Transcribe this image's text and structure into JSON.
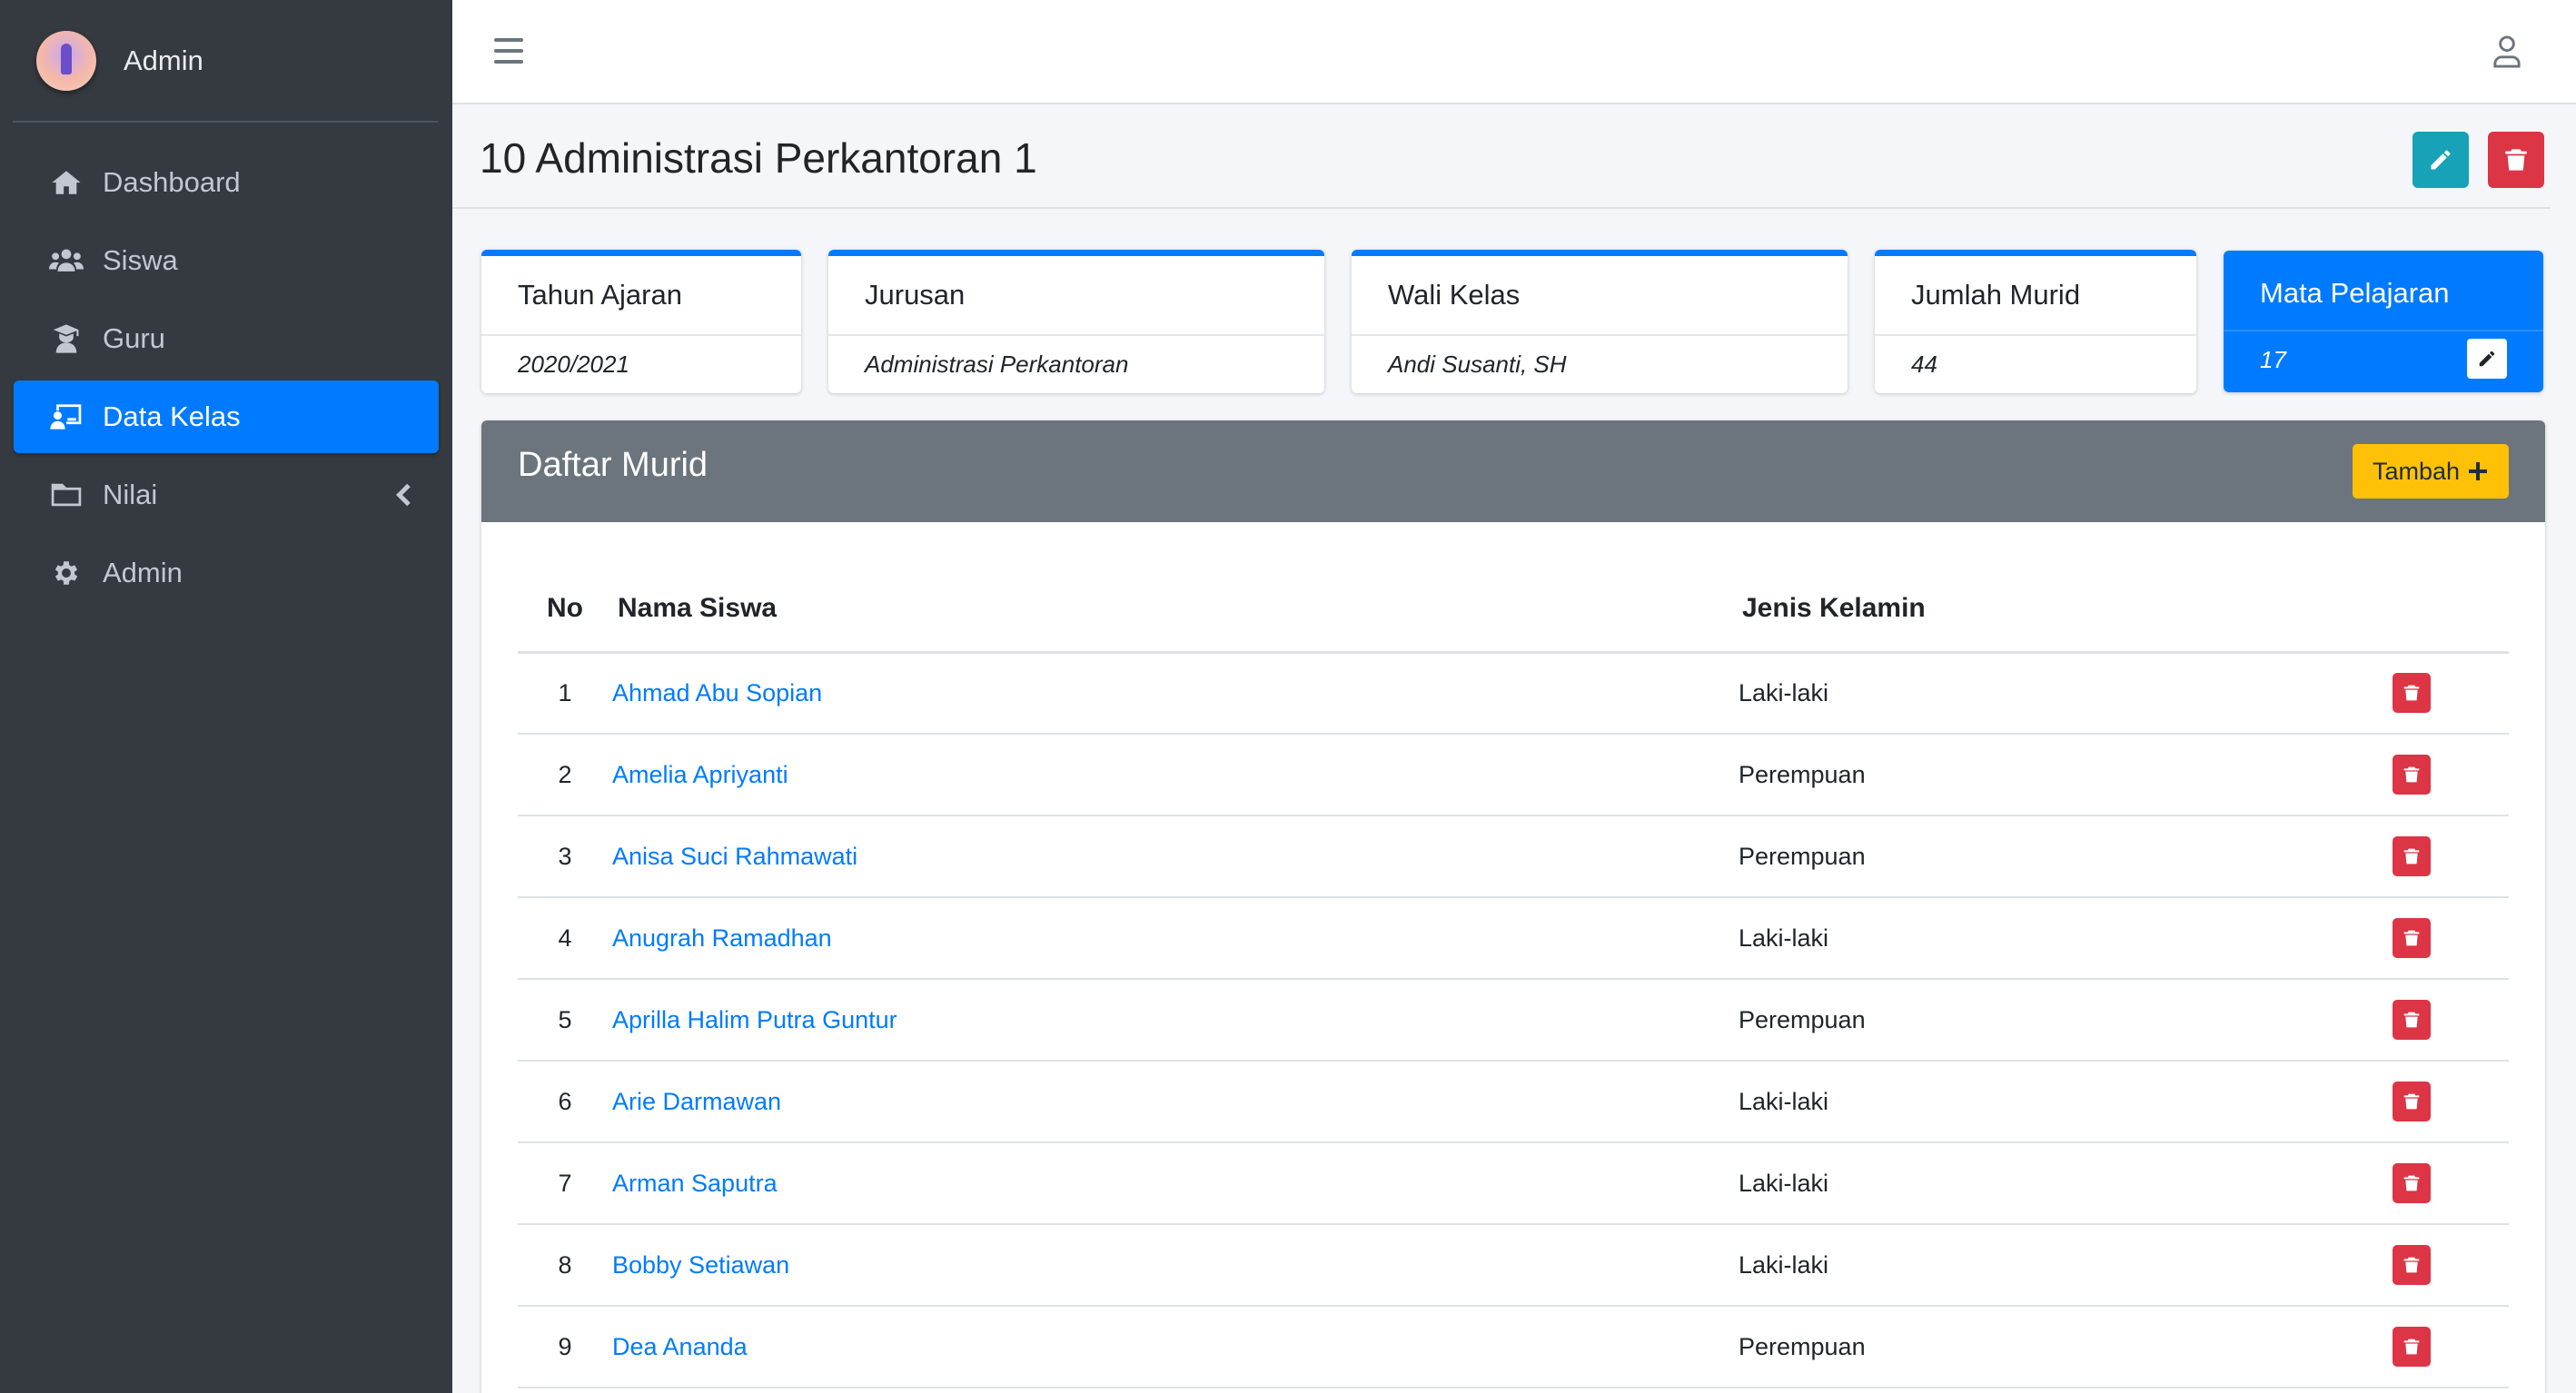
{
  "brand": {
    "user_name": "Admin"
  },
  "sidebar": {
    "items": [
      {
        "label": "Dashboard",
        "icon": "home-icon"
      },
      {
        "label": "Siswa",
        "icon": "users-icon"
      },
      {
        "label": "Guru",
        "icon": "teacher-icon"
      },
      {
        "label": "Data Kelas",
        "icon": "classroom-icon",
        "active": true
      },
      {
        "label": "Nilai",
        "icon": "folder-icon",
        "has_submenu": true
      },
      {
        "label": "Admin",
        "icon": "gear-icon"
      }
    ]
  },
  "page": {
    "title": "10 Administrasi Perkantoran 1"
  },
  "cards": [
    {
      "label": "Tahun Ajaran",
      "value": "2020/2021"
    },
    {
      "label": "Jurusan",
      "value": "Administrasi Perkantoran"
    },
    {
      "label": "Wali Kelas",
      "value": "Andi Susanti, SH"
    },
    {
      "label": "Jumlah Murid",
      "value": "44"
    },
    {
      "label": "Mata Pelajaran",
      "value": "17"
    }
  ],
  "students_panel": {
    "title": "Daftar Murid",
    "add_label": "Tambah",
    "columns": {
      "no": "No",
      "name": "Nama Siswa",
      "gender": "Jenis Kelamin"
    },
    "rows": [
      {
        "no": "1",
        "name": "Ahmad Abu Sopian",
        "gender": "Laki-laki"
      },
      {
        "no": "2",
        "name": "Amelia Apriyanti",
        "gender": "Perempuan"
      },
      {
        "no": "3",
        "name": "Anisa Suci Rahmawati",
        "gender": "Perempuan"
      },
      {
        "no": "4",
        "name": "Anugrah Ramadhan",
        "gender": "Laki-laki"
      },
      {
        "no": "5",
        "name": "Aprilla Halim Putra Guntur",
        "gender": "Perempuan"
      },
      {
        "no": "6",
        "name": "Arie Darmawan",
        "gender": "Laki-laki"
      },
      {
        "no": "7",
        "name": "Arman Saputra",
        "gender": "Laki-laki"
      },
      {
        "no": "8",
        "name": "Bobby Setiawan",
        "gender": "Laki-laki"
      },
      {
        "no": "9",
        "name": "Dea Ananda",
        "gender": "Perempuan"
      }
    ]
  },
  "colors": {
    "sidebar_bg": "#343a40",
    "primary": "#007bff",
    "info": "#17a2b8",
    "danger": "#dc3545",
    "warning": "#ffc107",
    "panel_header": "#6c757d"
  }
}
